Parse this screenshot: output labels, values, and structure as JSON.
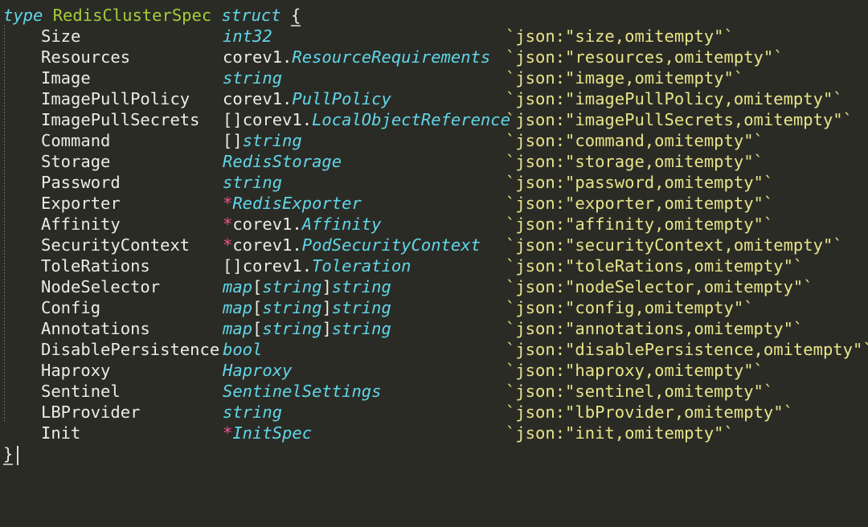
{
  "editor": {
    "language": "go",
    "background_color": "#2b2b26",
    "colors": {
      "keyword": "#5fd7e8",
      "identifier": "#a5ce3a",
      "plain": "#ecece6",
      "type": "#5fd7e8",
      "pointer": "#f0508a",
      "string_tag": "#e6e58a",
      "indent_guide": "#6b6b62"
    }
  },
  "code": {
    "header": {
      "keyword_type": "type",
      "struct_name": "RedisClusterSpec",
      "keyword_struct": "struct",
      "open_brace": "{"
    },
    "close_brace": "}",
    "fields": [
      {
        "name": "Size",
        "prefix": "",
        "pointer": "",
        "pkg": "",
        "type": "int32",
        "suffix": "",
        "tag": "`json:\"size,omitempty\"`"
      },
      {
        "name": "Resources",
        "prefix": "",
        "pointer": "",
        "pkg": "corev1.",
        "type": "ResourceRequirements",
        "suffix": "",
        "tag": "`json:\"resources,omitempty\"`"
      },
      {
        "name": "Image",
        "prefix": "",
        "pointer": "",
        "pkg": "",
        "type": "string",
        "suffix": "",
        "tag": "`json:\"image,omitempty\"`"
      },
      {
        "name": "ImagePullPolicy",
        "prefix": "",
        "pointer": "",
        "pkg": "corev1.",
        "type": "PullPolicy",
        "suffix": "",
        "tag": "`json:\"imagePullPolicy,omitempty\"`"
      },
      {
        "name": "ImagePullSecrets",
        "prefix": "[]",
        "pointer": "",
        "pkg": "corev1.",
        "type": "LocalObjectReference",
        "suffix": "",
        "tag": "`json:\"imagePullSecrets,omitempty\"`"
      },
      {
        "name": "Command",
        "prefix": "[]",
        "pointer": "",
        "pkg": "",
        "type": "string",
        "suffix": "",
        "tag": "`json:\"command,omitempty\"`"
      },
      {
        "name": "Storage",
        "prefix": "",
        "pointer": "",
        "pkg": "",
        "type": "RedisStorage",
        "suffix": "",
        "tag": "`json:\"storage,omitempty\"`"
      },
      {
        "name": "Password",
        "prefix": "",
        "pointer": "",
        "pkg": "",
        "type": "string",
        "suffix": "",
        "tag": "`json:\"password,omitempty\"`"
      },
      {
        "name": "Exporter",
        "prefix": "",
        "pointer": "*",
        "pkg": "",
        "type": "RedisExporter",
        "suffix": "",
        "tag": "`json:\"exporter,omitempty\"`"
      },
      {
        "name": "Affinity",
        "prefix": "",
        "pointer": "*",
        "pkg": "corev1.",
        "type": "Affinity",
        "suffix": "",
        "tag": "`json:\"affinity,omitempty\"`"
      },
      {
        "name": "SecurityContext",
        "prefix": "",
        "pointer": "*",
        "pkg": "corev1.",
        "type": "PodSecurityContext",
        "suffix": "",
        "tag": "`json:\"securityContext,omitempty\"`"
      },
      {
        "name": "ToleRations",
        "prefix": "[]",
        "pointer": "",
        "pkg": "corev1.",
        "type": "Toleration",
        "suffix": "",
        "tag": "`json:\"toleRations,omitempty\"`"
      },
      {
        "name": "NodeSelector",
        "prefix": "",
        "pointer": "",
        "pkg": "",
        "type": "map",
        "suffix": "map",
        "tag": "`json:\"nodeSelector,omitempty\"`"
      },
      {
        "name": "Config",
        "prefix": "",
        "pointer": "",
        "pkg": "",
        "type": "map",
        "suffix": "map",
        "tag": "`json:\"config,omitempty\"`"
      },
      {
        "name": "Annotations",
        "prefix": "",
        "pointer": "",
        "pkg": "",
        "type": "map",
        "suffix": "map",
        "tag": "`json:\"annotations,omitempty\"`"
      },
      {
        "name": "DisablePersistence",
        "prefix": "",
        "pointer": "",
        "pkg": "",
        "type": "bool",
        "suffix": "",
        "tag": "`json:\"disablePersistence,omitempty\"`"
      },
      {
        "name": "Haproxy",
        "prefix": "",
        "pointer": "",
        "pkg": "",
        "type": "Haproxy",
        "suffix": "",
        "tag": "`json:\"haproxy,omitempty\"`"
      },
      {
        "name": "Sentinel",
        "prefix": "",
        "pointer": "",
        "pkg": "",
        "type": "SentinelSettings",
        "suffix": "",
        "tag": "`json:\"sentinel,omitempty\"`"
      },
      {
        "name": "LBProvider",
        "prefix": "",
        "pointer": "",
        "pkg": "",
        "type": "string",
        "suffix": "",
        "tag": "`json:\"lbProvider,omitempty\"`"
      },
      {
        "name": "Init",
        "prefix": "",
        "pointer": "*",
        "pkg": "",
        "type": "InitSpec",
        "suffix": "",
        "tag": "`json:\"init,omitempty\"`"
      }
    ],
    "map_type": {
      "keyword": "map",
      "open_bracket": "[",
      "key_type": "string",
      "close_bracket": "]",
      "value_type": "string"
    }
  }
}
